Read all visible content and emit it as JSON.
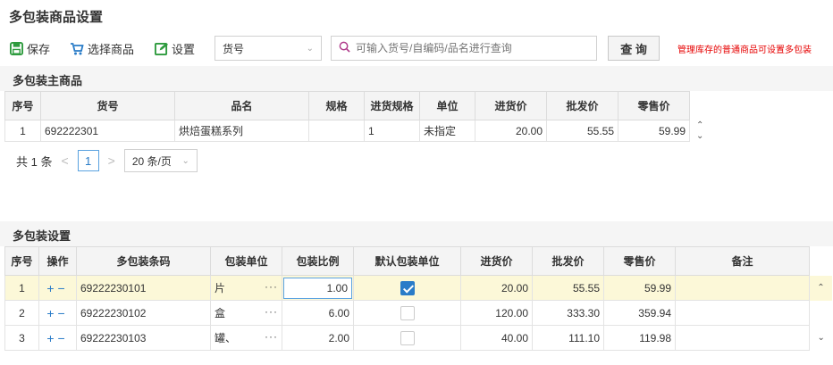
{
  "title": "多包装商品设置",
  "toolbar": {
    "save_label": "保存",
    "select_goods_label": "选择商品",
    "settings_label": "设置",
    "search_field_value": "货号",
    "search_placeholder": "可输入货号/自编码/品名进行查询",
    "query_label": "查 询",
    "note": "管理库存的普通商品可设置多包装"
  },
  "main_section": {
    "title": "多包装主商品",
    "columns": [
      "序号",
      "货号",
      "品名",
      "规格",
      "进货规格",
      "单位",
      "进货价",
      "批发价",
      "零售价"
    ],
    "rows": [
      {
        "no": "1",
        "code": "692222301",
        "name": "烘焙蛋糕系列",
        "spec": "",
        "purchase_spec": "1",
        "unit": "未指定",
        "purchase_price": "20.00",
        "wholesale_price": "55.55",
        "retail_price": "59.99"
      }
    ],
    "pager": {
      "total": "共 1 条",
      "prev": "<",
      "page": "1",
      "next": ">",
      "page_size": "20 条/页"
    }
  },
  "pack_section": {
    "title": "多包装设置",
    "columns": [
      "序号",
      "操作",
      "多包装条码",
      "包装单位",
      "包装比例",
      "默认包装单位",
      "进货价",
      "批发价",
      "零售价",
      "备注"
    ],
    "rows": [
      {
        "no": "1",
        "barcode": "69222230101",
        "unit": "片",
        "ratio": "1.00",
        "default": true,
        "purchase_price": "20.00",
        "wholesale_price": "55.55",
        "retail_price": "59.99",
        "remark": ""
      },
      {
        "no": "2",
        "barcode": "69222230102",
        "unit": "盒",
        "ratio": "6.00",
        "default": false,
        "purchase_price": "120.00",
        "wholesale_price": "333.30",
        "retail_price": "359.94",
        "remark": ""
      },
      {
        "no": "3",
        "barcode": "69222230103",
        "unit": "罐、",
        "ratio": "2.00",
        "default": false,
        "purchase_price": "40.00",
        "wholesale_price": "111.10",
        "retail_price": "119.98",
        "remark": ""
      }
    ]
  },
  "icons": {
    "save": "save-icon",
    "cart": "cart-icon",
    "settings": "edit-icon",
    "search": "search-icon"
  },
  "colors": {
    "accent": "#2a7cc8",
    "save_green": "#2e9b3e",
    "note_red": "#e60000"
  }
}
